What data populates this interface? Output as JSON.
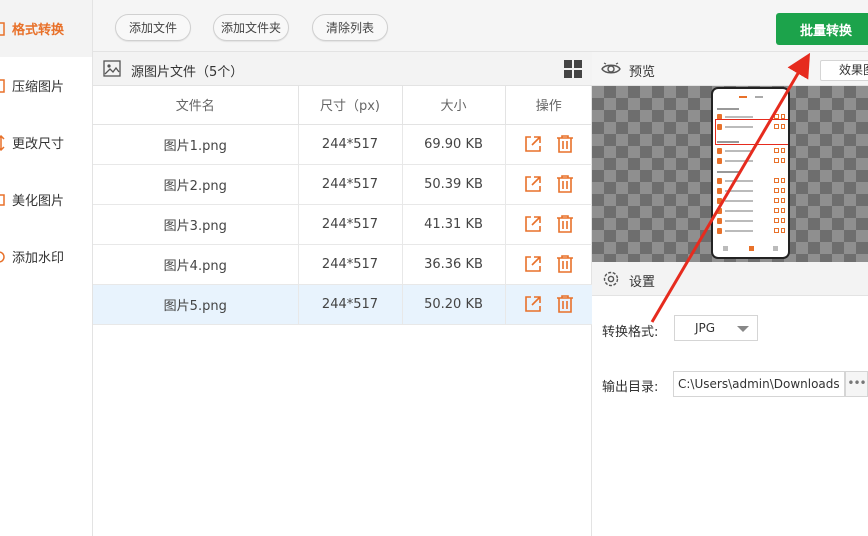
{
  "sidebar": {
    "items": [
      {
        "label": "格式转换",
        "active": true
      },
      {
        "label": "压缩图片",
        "active": false
      },
      {
        "label": "更改尺寸",
        "active": false
      },
      {
        "label": "美化图片",
        "active": false
      },
      {
        "label": "添加水印",
        "active": false
      }
    ]
  },
  "toolbar": {
    "add_file": "添加文件",
    "add_folder": "添加文件夹",
    "clear_list": "清除列表",
    "batch_convert": "批量转换"
  },
  "file_panel": {
    "title": "源图片文件（5个）",
    "columns": [
      "文件名",
      "尺寸（px)",
      "大小",
      "操作"
    ],
    "rows": [
      {
        "name": "图片1.png",
        "size_px": "244*517",
        "file_size": "69.90 KB"
      },
      {
        "name": "图片2.png",
        "size_px": "244*517",
        "file_size": "50.39 KB"
      },
      {
        "name": "图片3.png",
        "size_px": "244*517",
        "file_size": "41.31 KB"
      },
      {
        "name": "图片4.png",
        "size_px": "244*517",
        "file_size": "36.36 KB"
      },
      {
        "name": "图片5.png",
        "size_px": "244*517",
        "file_size": "50.20 KB",
        "selected": true
      }
    ]
  },
  "preview": {
    "title": "预览",
    "effect_button": "效果图"
  },
  "settings": {
    "title": "设置",
    "format_label": "转换格式:",
    "format_value": "JPG",
    "output_label": "输出目录:",
    "output_value": "C:\\Users\\admin\\Downloads",
    "more": "•••"
  },
  "colors": {
    "accent": "#e8712a",
    "primary": "#1ca34b",
    "annotation_arrow": "#e62b1e",
    "selected_row": "#e8f3fd"
  },
  "icons": {
    "image": "image-icon",
    "grid": "grid-view-icon",
    "open": "open-external-icon",
    "delete": "trash-icon",
    "preview": "eye-icon",
    "settings": "gear-icon"
  }
}
